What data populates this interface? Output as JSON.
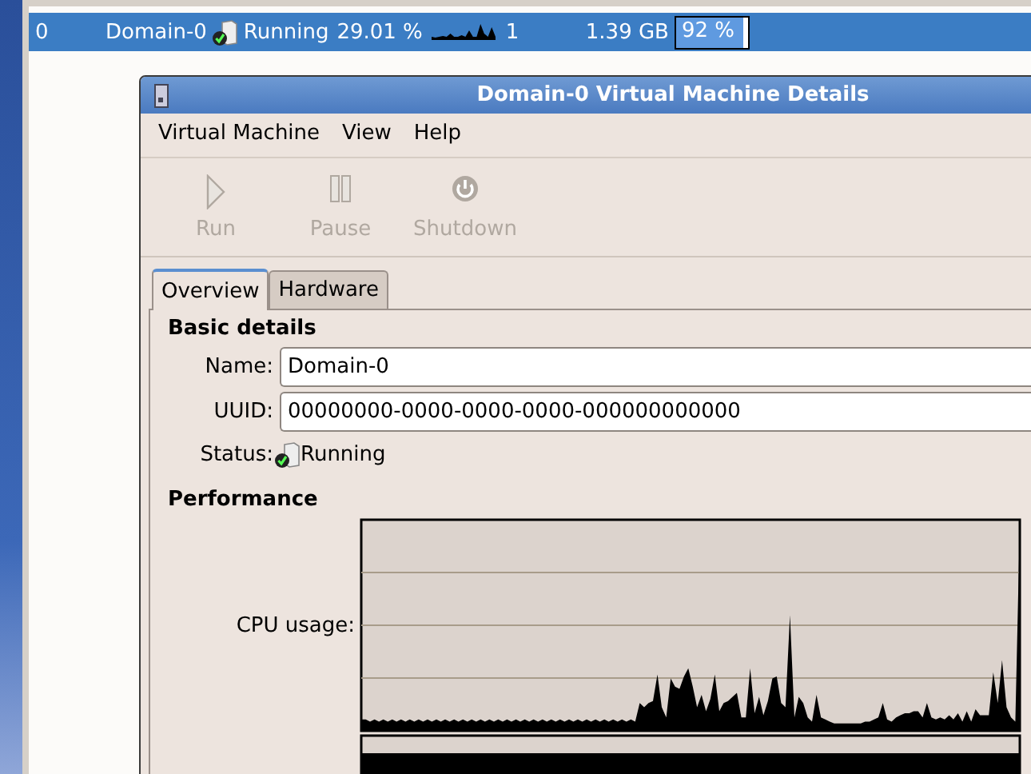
{
  "vm_row": {
    "id": "0",
    "name": "Domain-0",
    "status": "Running",
    "cpu": "29.01 %",
    "vcpus": "1",
    "memory": "1.39 GB",
    "memory_usage": {
      "level": 0.92,
      "reading": "92 %"
    },
    "selected": true
  },
  "window": {
    "title": "Domain-0 Virtual Machine Details"
  },
  "menu": [
    "Virtual Machine",
    "View",
    "Help"
  ],
  "toolbar": [
    {
      "label": "Run",
      "kind": "run",
      "disabled": true
    },
    {
      "label": "Pause",
      "kind": "pause",
      "disabled": true
    },
    {
      "label": "Shutdown",
      "kind": "shutdown",
      "disabled": true
    }
  ],
  "tabs": [
    {
      "label": "Overview",
      "selected": true
    },
    {
      "label": "Hardware",
      "selected": false
    }
  ],
  "basic_details": {
    "heading": "Basic details",
    "fields": [
      {
        "label": "Name:",
        "value": "Domain-0"
      },
      {
        "label": "UUID:",
        "value": "00000000-0000-0000-0000-000000000000"
      }
    ],
    "status_label": "Status:",
    "status": "Running"
  },
  "performance": {
    "heading": "Performance",
    "cpu_label": "CPU usage:"
  }
}
